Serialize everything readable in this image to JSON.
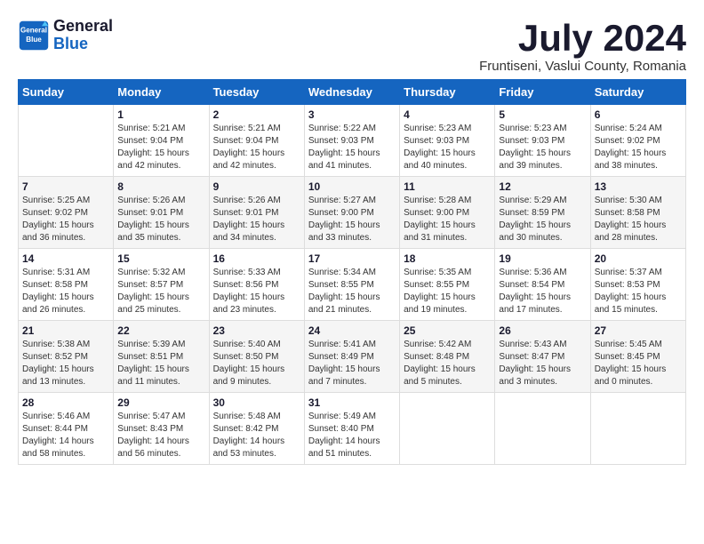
{
  "header": {
    "logo_line1": "General",
    "logo_line2": "Blue",
    "month_title": "July 2024",
    "subtitle": "Fruntiseni, Vaslui County, Romania"
  },
  "weekdays": [
    "Sunday",
    "Monday",
    "Tuesday",
    "Wednesday",
    "Thursday",
    "Friday",
    "Saturday"
  ],
  "weeks": [
    [
      {
        "day": "",
        "info": ""
      },
      {
        "day": "1",
        "info": "Sunrise: 5:21 AM\nSunset: 9:04 PM\nDaylight: 15 hours\nand 42 minutes."
      },
      {
        "day": "2",
        "info": "Sunrise: 5:21 AM\nSunset: 9:04 PM\nDaylight: 15 hours\nand 42 minutes."
      },
      {
        "day": "3",
        "info": "Sunrise: 5:22 AM\nSunset: 9:03 PM\nDaylight: 15 hours\nand 41 minutes."
      },
      {
        "day": "4",
        "info": "Sunrise: 5:23 AM\nSunset: 9:03 PM\nDaylight: 15 hours\nand 40 minutes."
      },
      {
        "day": "5",
        "info": "Sunrise: 5:23 AM\nSunset: 9:03 PM\nDaylight: 15 hours\nand 39 minutes."
      },
      {
        "day": "6",
        "info": "Sunrise: 5:24 AM\nSunset: 9:02 PM\nDaylight: 15 hours\nand 38 minutes."
      }
    ],
    [
      {
        "day": "7",
        "info": "Sunrise: 5:25 AM\nSunset: 9:02 PM\nDaylight: 15 hours\nand 36 minutes."
      },
      {
        "day": "8",
        "info": "Sunrise: 5:26 AM\nSunset: 9:01 PM\nDaylight: 15 hours\nand 35 minutes."
      },
      {
        "day": "9",
        "info": "Sunrise: 5:26 AM\nSunset: 9:01 PM\nDaylight: 15 hours\nand 34 minutes."
      },
      {
        "day": "10",
        "info": "Sunrise: 5:27 AM\nSunset: 9:00 PM\nDaylight: 15 hours\nand 33 minutes."
      },
      {
        "day": "11",
        "info": "Sunrise: 5:28 AM\nSunset: 9:00 PM\nDaylight: 15 hours\nand 31 minutes."
      },
      {
        "day": "12",
        "info": "Sunrise: 5:29 AM\nSunset: 8:59 PM\nDaylight: 15 hours\nand 30 minutes."
      },
      {
        "day": "13",
        "info": "Sunrise: 5:30 AM\nSunset: 8:58 PM\nDaylight: 15 hours\nand 28 minutes."
      }
    ],
    [
      {
        "day": "14",
        "info": "Sunrise: 5:31 AM\nSunset: 8:58 PM\nDaylight: 15 hours\nand 26 minutes."
      },
      {
        "day": "15",
        "info": "Sunrise: 5:32 AM\nSunset: 8:57 PM\nDaylight: 15 hours\nand 25 minutes."
      },
      {
        "day": "16",
        "info": "Sunrise: 5:33 AM\nSunset: 8:56 PM\nDaylight: 15 hours\nand 23 minutes."
      },
      {
        "day": "17",
        "info": "Sunrise: 5:34 AM\nSunset: 8:55 PM\nDaylight: 15 hours\nand 21 minutes."
      },
      {
        "day": "18",
        "info": "Sunrise: 5:35 AM\nSunset: 8:55 PM\nDaylight: 15 hours\nand 19 minutes."
      },
      {
        "day": "19",
        "info": "Sunrise: 5:36 AM\nSunset: 8:54 PM\nDaylight: 15 hours\nand 17 minutes."
      },
      {
        "day": "20",
        "info": "Sunrise: 5:37 AM\nSunset: 8:53 PM\nDaylight: 15 hours\nand 15 minutes."
      }
    ],
    [
      {
        "day": "21",
        "info": "Sunrise: 5:38 AM\nSunset: 8:52 PM\nDaylight: 15 hours\nand 13 minutes."
      },
      {
        "day": "22",
        "info": "Sunrise: 5:39 AM\nSunset: 8:51 PM\nDaylight: 15 hours\nand 11 minutes."
      },
      {
        "day": "23",
        "info": "Sunrise: 5:40 AM\nSunset: 8:50 PM\nDaylight: 15 hours\nand 9 minutes."
      },
      {
        "day": "24",
        "info": "Sunrise: 5:41 AM\nSunset: 8:49 PM\nDaylight: 15 hours\nand 7 minutes."
      },
      {
        "day": "25",
        "info": "Sunrise: 5:42 AM\nSunset: 8:48 PM\nDaylight: 15 hours\nand 5 minutes."
      },
      {
        "day": "26",
        "info": "Sunrise: 5:43 AM\nSunset: 8:47 PM\nDaylight: 15 hours\nand 3 minutes."
      },
      {
        "day": "27",
        "info": "Sunrise: 5:45 AM\nSunset: 8:45 PM\nDaylight: 15 hours\nand 0 minutes."
      }
    ],
    [
      {
        "day": "28",
        "info": "Sunrise: 5:46 AM\nSunset: 8:44 PM\nDaylight: 14 hours\nand 58 minutes."
      },
      {
        "day": "29",
        "info": "Sunrise: 5:47 AM\nSunset: 8:43 PM\nDaylight: 14 hours\nand 56 minutes."
      },
      {
        "day": "30",
        "info": "Sunrise: 5:48 AM\nSunset: 8:42 PM\nDaylight: 14 hours\nand 53 minutes."
      },
      {
        "day": "31",
        "info": "Sunrise: 5:49 AM\nSunset: 8:40 PM\nDaylight: 14 hours\nand 51 minutes."
      },
      {
        "day": "",
        "info": ""
      },
      {
        "day": "",
        "info": ""
      },
      {
        "day": "",
        "info": ""
      }
    ]
  ]
}
